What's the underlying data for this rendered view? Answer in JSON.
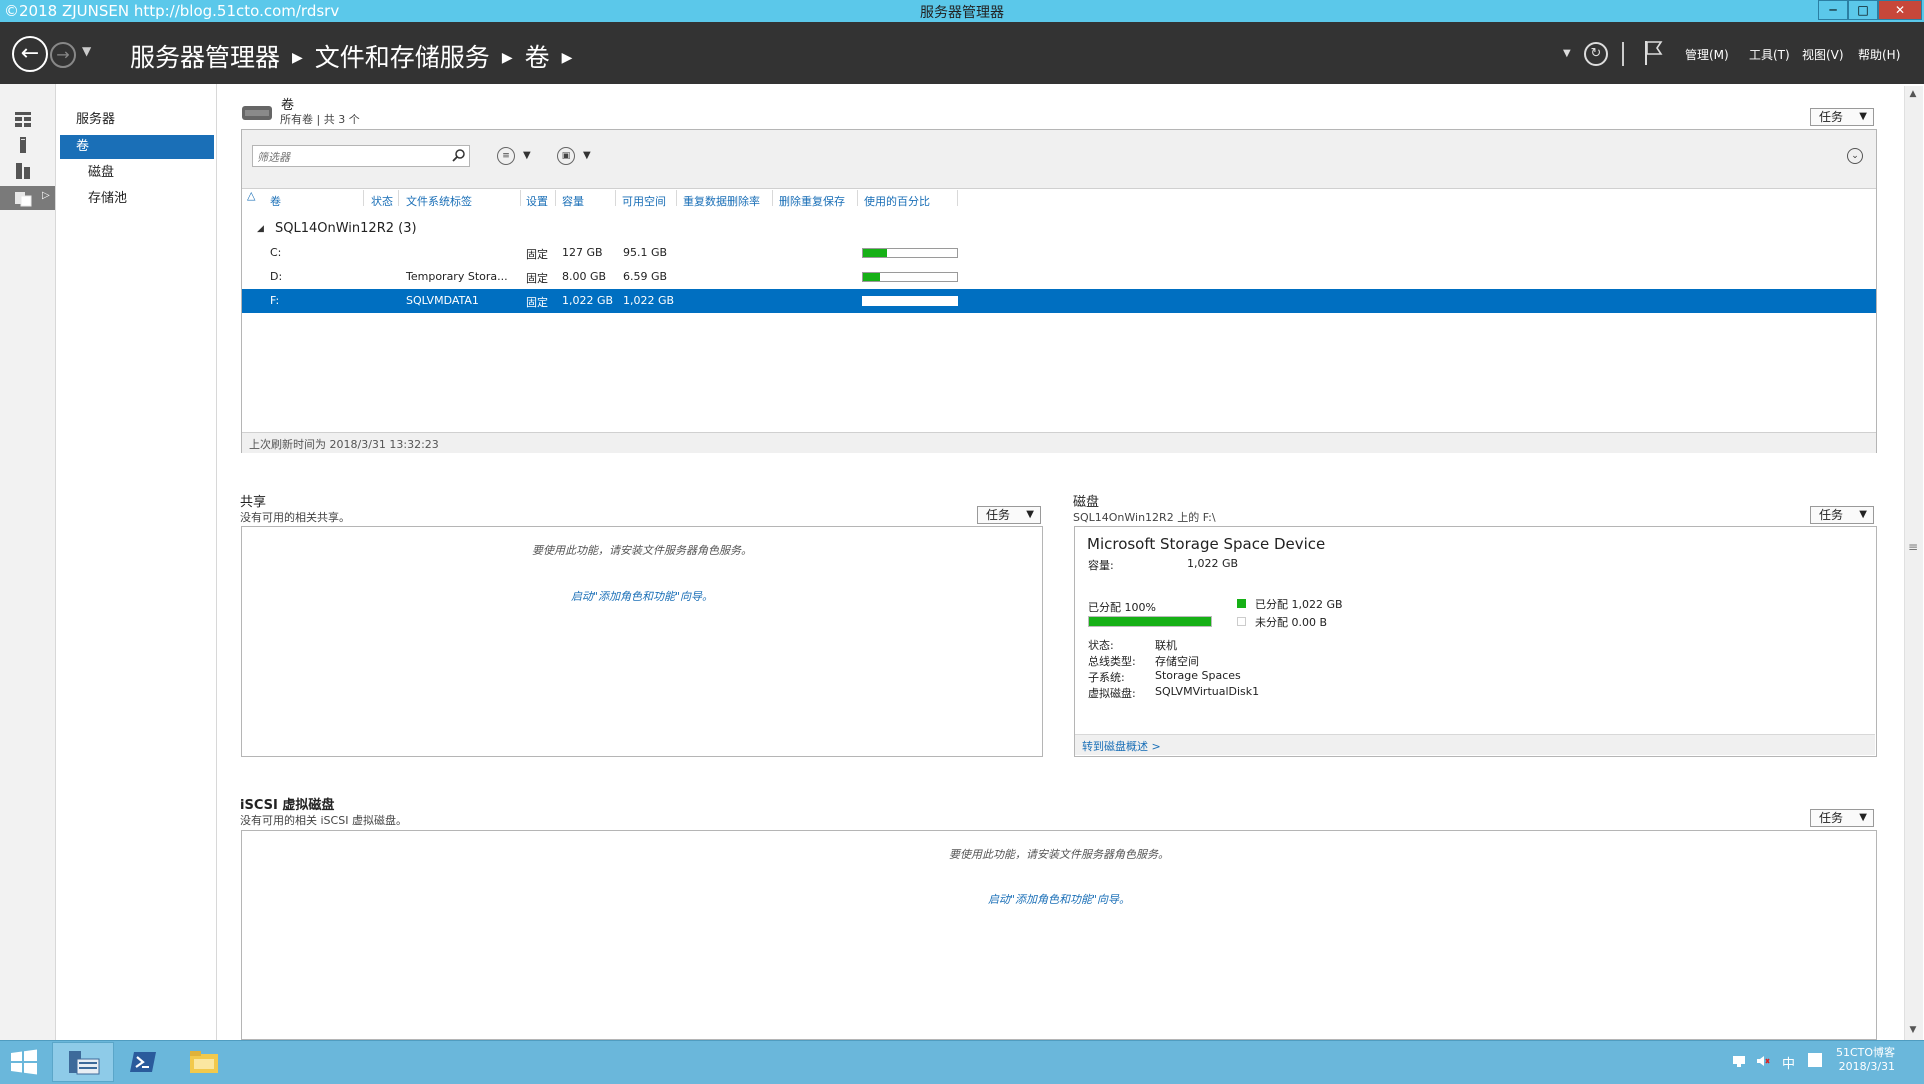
{
  "window": {
    "watermark": "©2018 ZJUNSEN  http://blog.51cto.com/rdsrv",
    "title": "服务器管理器",
    "minimize": "─",
    "maximize": "□",
    "close": "✕"
  },
  "header": {
    "breadcrumb": [
      "服务器管理器",
      "文件和存储服务",
      "卷"
    ],
    "menus": {
      "manage": "管理(M)",
      "tools": "工具(T)",
      "view": "视图(V)",
      "help": "帮助(H)"
    }
  },
  "nav": {
    "items": [
      {
        "label": "服务器",
        "selected": false,
        "indent": false
      },
      {
        "label": "卷",
        "selected": true,
        "indent": false
      },
      {
        "label": "磁盘",
        "selected": false,
        "indent": true
      },
      {
        "label": "存储池",
        "selected": false,
        "indent": true
      }
    ]
  },
  "volumes": {
    "title": "卷",
    "subtitle": "所有卷 | 共 3 个",
    "task_label": "任务",
    "filter_placeholder": "筛选器",
    "columns": [
      "卷",
      "状态",
      "文件系统标签",
      "设置",
      "容量",
      "可用空间",
      "重复数据删除率",
      "删除重复保存",
      "使用的百分比"
    ],
    "group": "SQL14OnWin12R2 (3)",
    "rows": [
      {
        "volume": "C:",
        "status": "",
        "label": "",
        "setting": "固定",
        "capacity": "127 GB",
        "free": "95.1 GB",
        "used_fraction": 0.25,
        "selected": false
      },
      {
        "volume": "D:",
        "status": "",
        "label": "Temporary Stora...",
        "setting": "固定",
        "capacity": "8.00 GB",
        "free": "6.59 GB",
        "used_fraction": 0.18,
        "selected": false
      },
      {
        "volume": "F:",
        "status": "",
        "label": "SQLVMDATA1",
        "setting": "固定",
        "capacity": "1,022 GB",
        "free": "1,022 GB",
        "used_fraction": 0.0,
        "selected": true
      }
    ],
    "last_refresh": "上次刷新时间为 2018/3/31 13:32:23"
  },
  "shares": {
    "title": "共享",
    "subtitle": "没有可用的相关共享。",
    "task_label": "任务",
    "message": "要使用此功能，请安装文件服务器角色服务。",
    "link": "启动\"添加角色和功能\"向导。"
  },
  "disk": {
    "title": "磁盘",
    "subtitle": "SQL14OnWin12R2 上的 F:\\",
    "task_label": "任务",
    "device_name": "Microsoft Storage Space Device",
    "capacity_label": "容量:",
    "capacity_value": "1,022 GB",
    "allocated_label": "已分配 100%",
    "allocated_fraction": 1.0,
    "legend_allocated": "已分配 1,022 GB",
    "legend_unallocated": "未分配 0.00 B",
    "props": [
      {
        "label": "状态:",
        "value": "联机"
      },
      {
        "label": "总线类型:",
        "value": "存储空间"
      },
      {
        "label": "子系统:",
        "value": "Storage Spaces"
      },
      {
        "label": "虚拟磁盘:",
        "value": "SQLVMVirtualDisk1"
      }
    ],
    "link": "转到磁盘概述 >",
    "colors": {
      "allocated": "#16b016",
      "unallocated": "#ffffff"
    }
  },
  "iscsi": {
    "title": "iSCSI 虚拟磁盘",
    "subtitle": "没有可用的相关 iSCSI 虚拟磁盘。",
    "task_label": "任务",
    "message": "要使用此功能，请安装文件服务器角色服务。",
    "link": "启动\"添加角色和功能\"向导。"
  },
  "taskbar": {
    "tray_text": "51CTO博客",
    "tray_sub": "2018/3/31",
    "ime": "中"
  },
  "colors": {
    "titlebar": "#5bc8ea",
    "header": "#333333",
    "accent": "#1a6fb7",
    "selection": "#006fc1",
    "taskbar": "#6ab7db"
  }
}
